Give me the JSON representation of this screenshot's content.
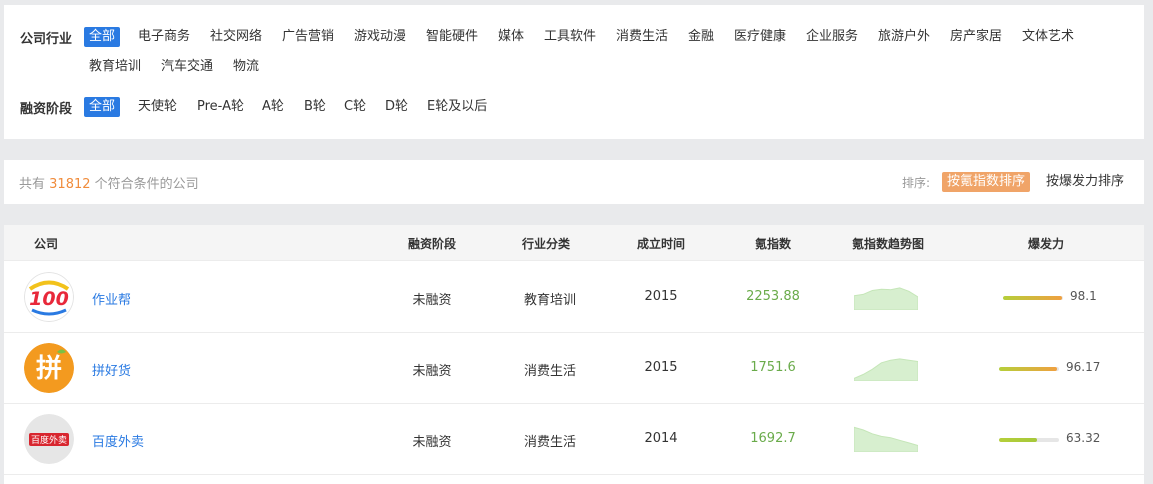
{
  "filters": {
    "industry": {
      "label": "公司行业",
      "options": [
        "全部",
        "电子商务",
        "社交网络",
        "广告营销",
        "游戏动漫",
        "智能硬件",
        "媒体",
        "工具软件",
        "消费生活",
        "金融",
        "医疗健康",
        "企业服务",
        "旅游户外",
        "房产家居",
        "文体艺术",
        "教育培训",
        "汽车交通",
        "物流"
      ],
      "selected": "全部"
    },
    "stage": {
      "label": "融资阶段",
      "options": [
        "全部",
        "天使轮",
        "Pre-A轮",
        "A轮",
        "B轮",
        "C轮",
        "D轮",
        "E轮及以后"
      ],
      "selected": "全部"
    }
  },
  "summary": {
    "prefix": "共有",
    "count": "31812",
    "suffix": "个符合条件的公司",
    "sort_label": "排序:",
    "sort_options": [
      "按氪指数排序",
      "按爆发力排序"
    ],
    "sort_selected": "按氪指数排序"
  },
  "table": {
    "headers": [
      "公司",
      "融资阶段",
      "行业分类",
      "成立时间",
      "氪指数",
      "氪指数趋势图",
      "爆发力"
    ],
    "rows": [
      {
        "name": "作业帮",
        "logo": "logo-100-icon",
        "stage": "未融资",
        "industry": "教育培训",
        "founded": "2015",
        "score": "2253.88",
        "burst": "98.1",
        "burst_fraction": 0.98,
        "trend": [
          0.55,
          0.6,
          0.75,
          0.8,
          0.78,
          0.85,
          0.72,
          0.5
        ]
      },
      {
        "name": "拼好货",
        "logo": "logo-pin-icon",
        "stage": "未融资",
        "industry": "消费生活",
        "founded": "2015",
        "score": "1751.6",
        "burst": "96.17",
        "burst_fraction": 0.96,
        "trend": [
          0.1,
          0.25,
          0.45,
          0.7,
          0.8,
          0.85,
          0.8,
          0.75
        ]
      },
      {
        "name": "百度外卖",
        "logo": "logo-baidu-waimai-icon",
        "stage": "未融资",
        "industry": "消费生活",
        "founded": "2014",
        "score": "1692.7",
        "burst": "63.32",
        "burst_fraction": 0.63,
        "trend": [
          0.95,
          0.85,
          0.7,
          0.6,
          0.55,
          0.45,
          0.35,
          0.25
        ]
      }
    ]
  },
  "colors": {
    "accent_blue": "#2a7ae2",
    "sort_active": "#f0a468",
    "score_green": "#6aab4a",
    "count_orange": "#f08c3c",
    "trend_fill": "#d7efcf"
  }
}
